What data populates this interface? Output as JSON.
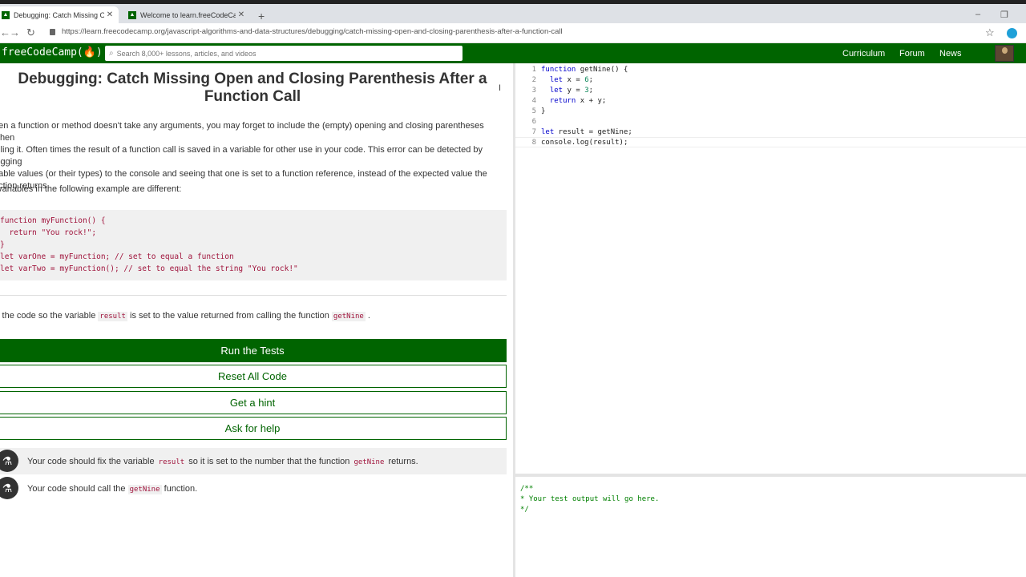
{
  "browser": {
    "tabs": [
      {
        "title": "Debugging: Catch Missing Open",
        "favicon": "fcc-favicon"
      },
      {
        "title": "Welcome to learn.freeCodeCamp",
        "favicon": "fcc-favicon"
      }
    ],
    "new_tab": "+",
    "url": "https://learn.freecodecamp.org/javascript-algorithms-and-data-structures/debugging/catch-missing-open-and-closing-parenthesis-after-a-function-call",
    "window_controls": {
      "minimize": "–",
      "restore": "❐"
    }
  },
  "nav": {
    "logo": "freeCodeCamp(🔥)",
    "search_placeholder": "Search 8,000+ lessons, articles, and videos",
    "links": [
      "Curriculum",
      "Forum",
      "News"
    ]
  },
  "challenge": {
    "title": "Debugging: Catch Missing Open and Closing Parenthesis After a Function Call",
    "description_lines": [
      "hen a function or method doesn't take any arguments, you may forget to include the (empty) opening and closing parentheses when",
      "alling it. Often times the result of a function call is saved in a variable for other use in your code. This error can be detected by logging",
      "riable values (or their types) to the console and seeing that one is set to a function reference, instead of the expected value the",
      "nction returns."
    ],
    "example_intro": "e variables in the following example are different:",
    "example_code": "function myFunction() {\n  return \"You rock!\";\n}\nlet varOne = myFunction; // set to equal a function\nlet varTwo = myFunction(); // set to equal the string \"You rock!\"",
    "task_pre": "x the code so the variable ",
    "task_code1": "result",
    "task_mid": " is set to the value returned from calling the function ",
    "task_code2": "getNine",
    "task_post": " ."
  },
  "buttons": {
    "run": "Run the Tests",
    "reset": "Reset All Code",
    "hint": "Get a hint",
    "help": "Ask for help"
  },
  "tests": [
    {
      "pre": "Your code should fix the variable ",
      "code1": "result",
      "mid": " so it is set to the number that the function ",
      "code2": "getNine",
      "post": " returns."
    },
    {
      "pre": "Your code should call the ",
      "code1": "getNine",
      "mid": " function.",
      "code2": "",
      "post": ""
    }
  ],
  "editor": {
    "line_numbers": [
      "1",
      "2",
      "3",
      "4",
      "5",
      "6",
      "7",
      "8"
    ]
  },
  "output": "/**\n* Your test output will go here.\n*/"
}
